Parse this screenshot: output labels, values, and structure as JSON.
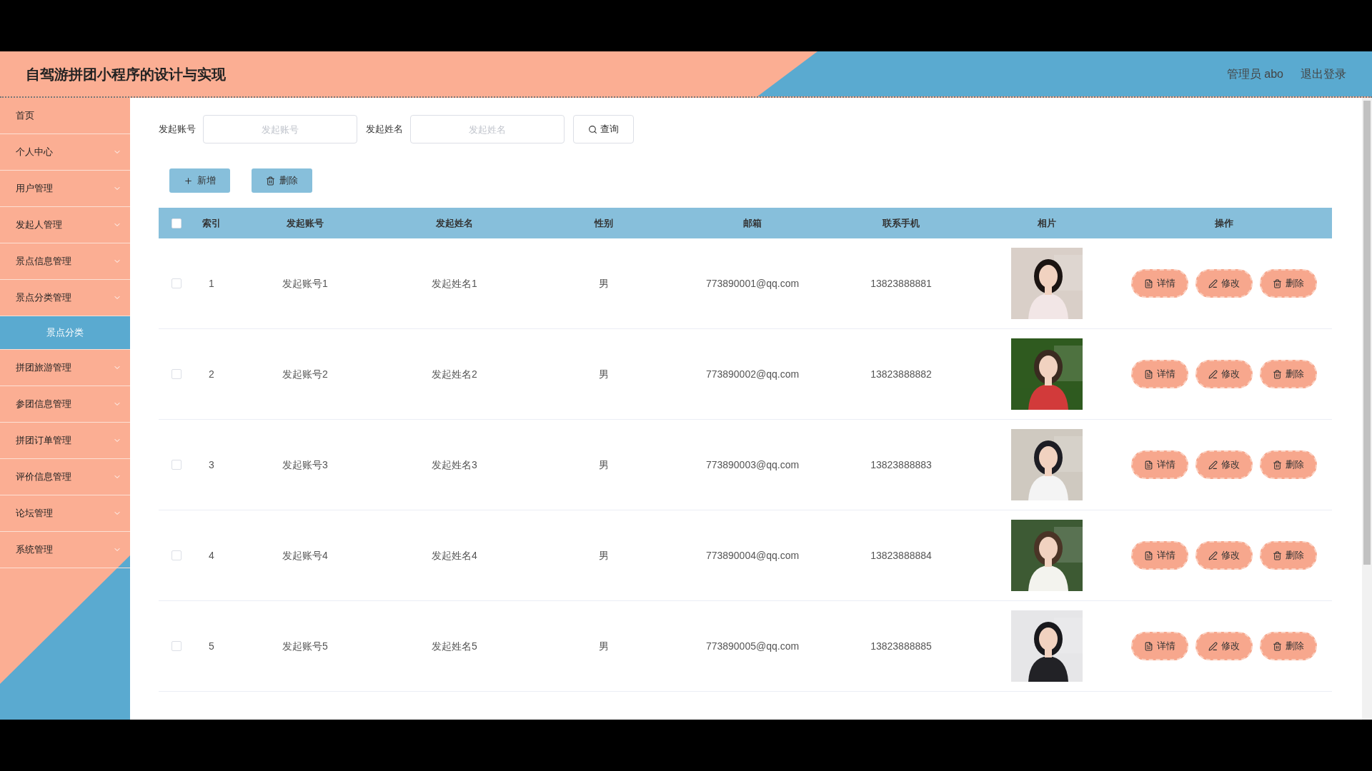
{
  "header": {
    "title": "自驾游拼团小程序的设计与实现",
    "user": "管理员 abo",
    "logout": "退出登录"
  },
  "sidebar": {
    "items": [
      {
        "kind": "link",
        "label": "首页"
      },
      {
        "kind": "menu",
        "label": "个人中心"
      },
      {
        "kind": "menu",
        "label": "用户管理"
      },
      {
        "kind": "menu",
        "label": "发起人管理"
      },
      {
        "kind": "menu",
        "label": "景点信息管理"
      },
      {
        "kind": "menu",
        "label": "景点分类管理",
        "children": [
          {
            "label": "景点分类",
            "selected": true
          }
        ]
      },
      {
        "kind": "menu",
        "label": "拼团旅游管理"
      },
      {
        "kind": "menu",
        "label": "参团信息管理"
      },
      {
        "kind": "menu",
        "label": "拼团订单管理"
      },
      {
        "kind": "menu",
        "label": "评价信息管理"
      },
      {
        "kind": "menu",
        "label": "论坛管理"
      },
      {
        "kind": "menu",
        "label": "系统管理"
      }
    ]
  },
  "search": {
    "fields": [
      {
        "label": "发起账号",
        "placeholder": "发起账号"
      },
      {
        "label": "发起姓名",
        "placeholder": "发起姓名"
      }
    ],
    "button": "查询"
  },
  "toolbar": [
    {
      "kind": "add",
      "label": "新增"
    },
    {
      "kind": "delete",
      "label": "删除"
    }
  ],
  "table": {
    "select_all": {
      "checked": false
    },
    "columns": [
      "索引",
      "发起账号",
      "发起姓名",
      "性别",
      "邮箱",
      "联系手机",
      "相片",
      "操作"
    ],
    "rows": [
      {
        "checked": false,
        "index": "1",
        "account": "发起账号1",
        "name": "发起姓名1",
        "gender": "男",
        "email": "773890001@qq.com",
        "phone": "13823888881",
        "actions": [
          {
            "kind": "detail",
            "label": "详情"
          },
          {
            "kind": "edit",
            "label": "修改"
          },
          {
            "kind": "delete",
            "label": "删除"
          }
        ]
      },
      {
        "checked": false,
        "index": "2",
        "account": "发起账号2",
        "name": "发起姓名2",
        "gender": "男",
        "email": "773890002@qq.com",
        "phone": "13823888882",
        "actions": [
          {
            "kind": "detail",
            "label": "详情"
          },
          {
            "kind": "edit",
            "label": "修改"
          },
          {
            "kind": "delete",
            "label": "删除"
          }
        ]
      },
      {
        "checked": false,
        "index": "3",
        "account": "发起账号3",
        "name": "发起姓名3",
        "gender": "男",
        "email": "773890003@qq.com",
        "phone": "13823888883",
        "actions": [
          {
            "kind": "detail",
            "label": "详情"
          },
          {
            "kind": "edit",
            "label": "修改"
          },
          {
            "kind": "delete",
            "label": "删除"
          }
        ]
      },
      {
        "checked": false,
        "index": "4",
        "account": "发起账号4",
        "name": "发起姓名4",
        "gender": "男",
        "email": "773890004@qq.com",
        "phone": "13823888884",
        "actions": [
          {
            "kind": "detail",
            "label": "详情"
          },
          {
            "kind": "edit",
            "label": "修改"
          },
          {
            "kind": "delete",
            "label": "删除"
          }
        ]
      },
      {
        "checked": false,
        "index": "5",
        "account": "发起账号5",
        "name": "发起姓名5",
        "gender": "男",
        "email": "773890005@qq.com",
        "phone": "13823888885",
        "actions": [
          {
            "kind": "detail",
            "label": "详情"
          },
          {
            "kind": "edit",
            "label": "修改"
          },
          {
            "kind": "delete",
            "label": "删除"
          }
        ]
      }
    ]
  }
}
